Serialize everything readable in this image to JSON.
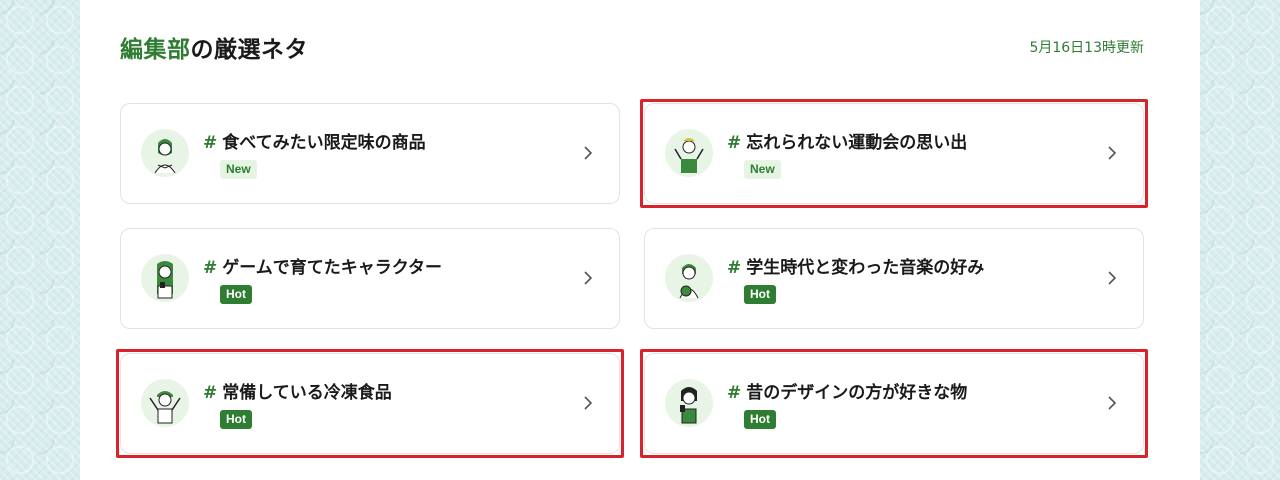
{
  "header": {
    "title_accent": "編集部",
    "title_rest": "の厳選ネタ",
    "updated": "5月16日13時更新"
  },
  "cards": [
    {
      "title": "食べてみたい限定味の商品",
      "badge": "New",
      "highlighted": false
    },
    {
      "title": "忘れられない運動会の思い出",
      "badge": "New",
      "highlighted": true
    },
    {
      "title": "ゲームで育てたキャラクター",
      "badge": "Hot",
      "highlighted": false
    },
    {
      "title": "学生時代と変わった音楽の好み",
      "badge": "Hot",
      "highlighted": false
    },
    {
      "title": "常備している冷凍食品",
      "badge": "Hot",
      "highlighted": true
    },
    {
      "title": "昔のデザインの方が好きな物",
      "badge": "Hot",
      "highlighted": true
    }
  ],
  "hash_symbol": "#",
  "colors": {
    "accent": "#2e7d32",
    "highlight": "#d8232a",
    "new_badge_bg": "#e6f4e4"
  }
}
